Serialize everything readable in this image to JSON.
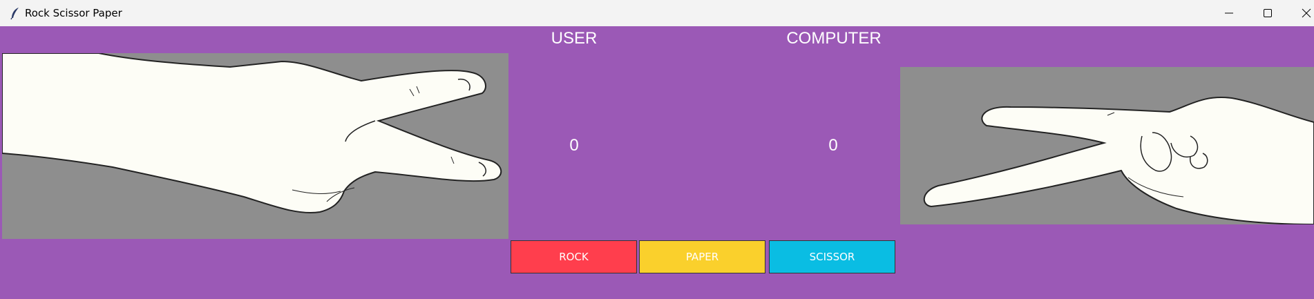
{
  "window": {
    "title": "Rock Scissor Paper",
    "icon": "feather-icon",
    "controls": [
      "minimize-icon",
      "maximize-icon",
      "close-icon"
    ]
  },
  "headers": {
    "user": "USER",
    "computer": "COMPUTER"
  },
  "scores": {
    "user": "0",
    "computer": "0"
  },
  "images": {
    "user_choice": "scissor-hand-image",
    "computer_choice": "scissor-hand-image"
  },
  "buttons": {
    "rock": {
      "label": "ROCK",
      "color": "#ff3e4d"
    },
    "paper": {
      "label": "PAPER",
      "color": "#fad02c"
    },
    "scissor": {
      "label": "SCISSOR",
      "color": "#0abde3"
    }
  },
  "colors": {
    "background": "#9b59b6",
    "image_background": "#8e8e8e",
    "hand": "#fdfdf6"
  }
}
